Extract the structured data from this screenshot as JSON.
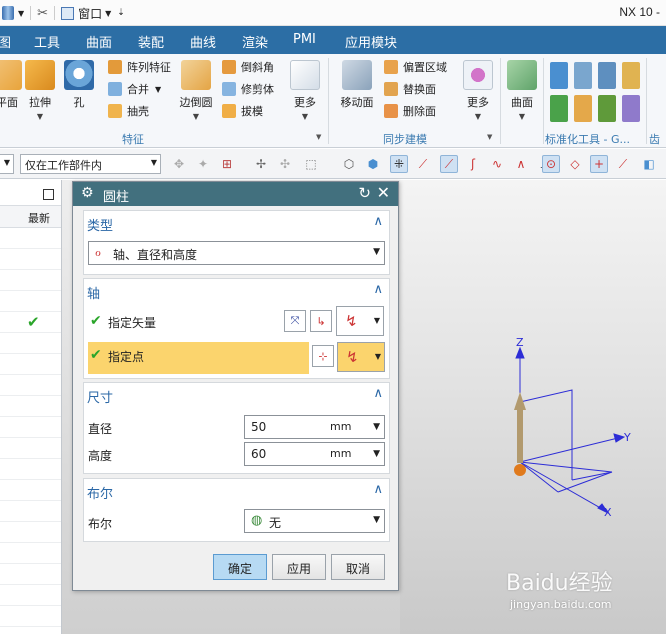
{
  "app": {
    "title": "NX 10 -",
    "window_menu": "窗口"
  },
  "colors": {
    "menubar": "#2c6ea5",
    "dialog_title": "#42707e",
    "selected_row": "#fbd46d",
    "accent_text": "#2a67a6",
    "check": "#2aa52a"
  },
  "menu": {
    "tabs": [
      "图",
      "工具",
      "曲面",
      "装配",
      "曲线",
      "渲染",
      "PMI",
      "应用模块"
    ]
  },
  "ribbon": {
    "big_buttons": [
      "平面",
      "拉伸",
      "孔",
      "边倒圆",
      "更多",
      "移动面",
      "更多",
      "曲面"
    ],
    "feature_small": [
      "阵列特征",
      "合并",
      "抽壳"
    ],
    "detail_small": [
      "倒斜角",
      "修剪体",
      "拔模"
    ],
    "sync_small": [
      "偏置区域",
      "替换面",
      "删除面"
    ],
    "groups": [
      "特征",
      "同步建模",
      "标准化工具 - G...",
      "齿轮"
    ]
  },
  "filterbar": {
    "scope": "仅在工作部件内"
  },
  "navigator": {
    "column_latest": "最新"
  },
  "dialog": {
    "title": "圆柱",
    "type_section": {
      "label": "类型",
      "value": "轴、直径和高度"
    },
    "axis_section": {
      "label": "轴",
      "vector_label": "指定矢量",
      "point_label": "指定点"
    },
    "dims_section": {
      "label": "尺寸",
      "diameter_label": "直径",
      "diameter_value": "50",
      "diameter_unit": "mm",
      "height_label": "高度",
      "height_value": "60",
      "height_unit": "mm"
    },
    "boolean_section": {
      "label": "布尔",
      "field_label": "布尔",
      "value": "无"
    },
    "buttons": {
      "ok": "确定",
      "apply": "应用",
      "cancel": "取消"
    }
  },
  "triad": {
    "x": "X",
    "y": "Y",
    "z": "Z"
  },
  "watermark": {
    "brand": "Baidu经验",
    "url": "jingyan.baidu.com"
  }
}
